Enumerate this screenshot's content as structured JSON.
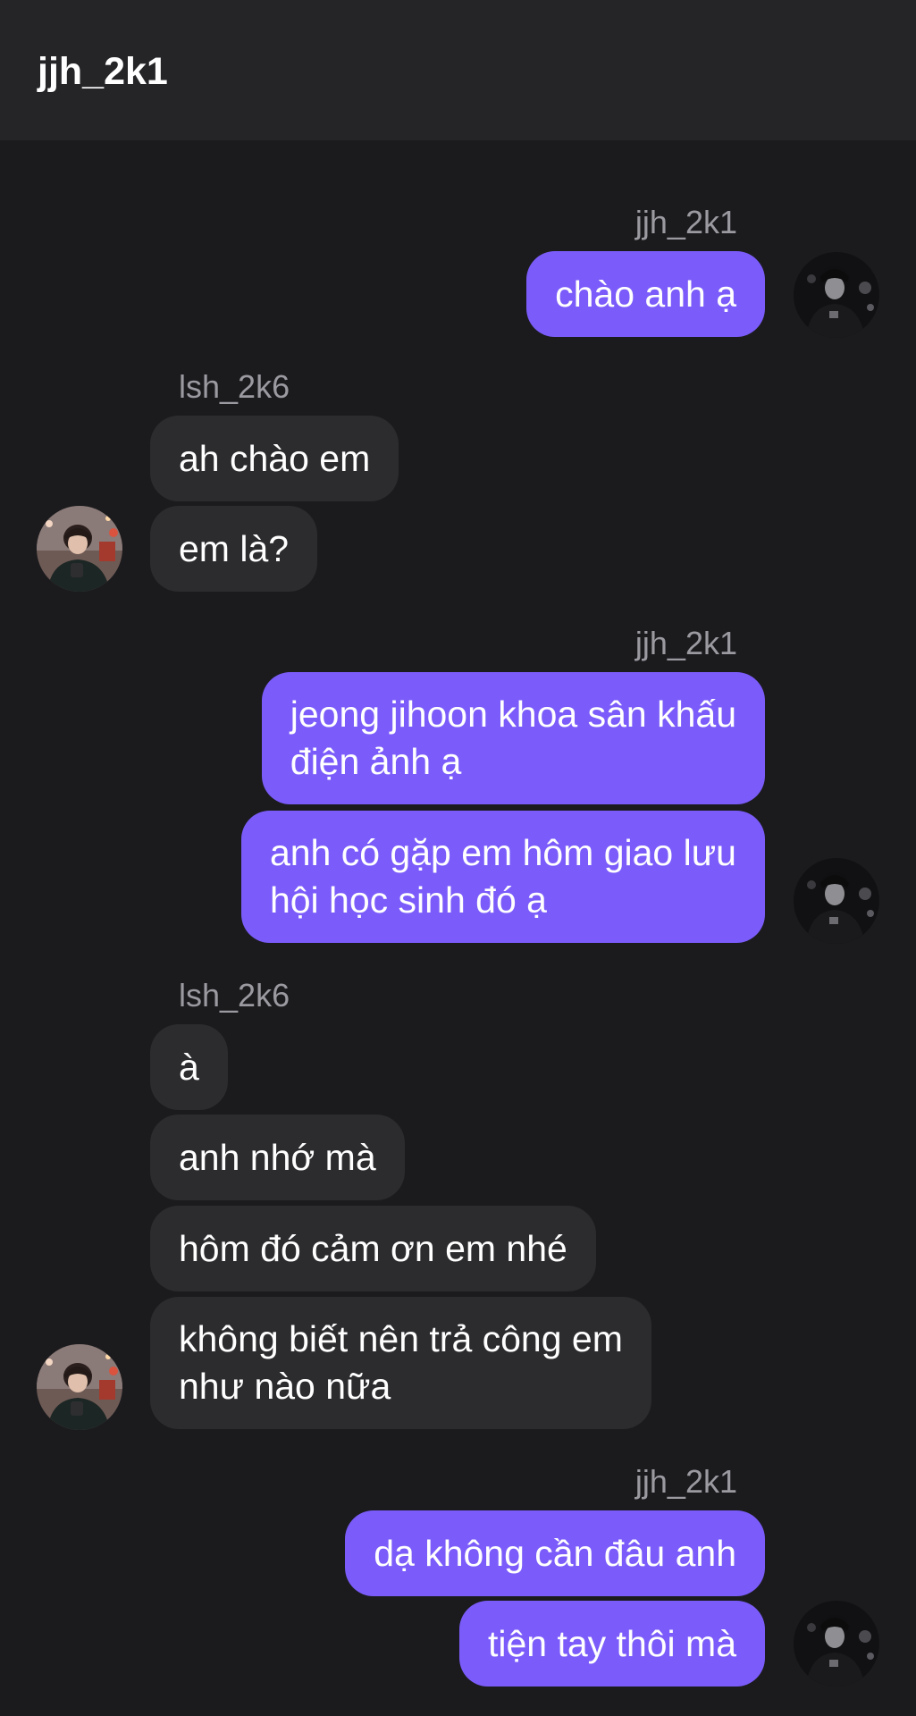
{
  "header": {
    "title": "jjh_2k1"
  },
  "users": {
    "me": "jjh_2k1",
    "other": "lsh_2k6"
  },
  "avatars": {
    "me": "profile-photo-jjh_2k1",
    "other": "profile-photo-lsh_2k6"
  },
  "messages": [
    {
      "sender": "jjh_2k1",
      "text": "chào anh ạ"
    },
    {
      "sender": "lsh_2k6",
      "text": "ah chào em"
    },
    {
      "sender": "lsh_2k6",
      "text": "em là?"
    },
    {
      "sender": "jjh_2k1",
      "text": "jeong jihoon khoa sân khấu\nđiện ảnh ạ"
    },
    {
      "sender": "jjh_2k1",
      "text": "anh có gặp em hôm giao lưu\nhội học sinh đó ạ"
    },
    {
      "sender": "lsh_2k6",
      "text": "à"
    },
    {
      "sender": "lsh_2k6",
      "text": "anh nhớ mà"
    },
    {
      "sender": "lsh_2k6",
      "text": "hôm đó cảm ơn em nhé"
    },
    {
      "sender": "lsh_2k6",
      "text": "không biết nên trả công em\nnhư nào nữa"
    },
    {
      "sender": "jjh_2k1",
      "text": "dạ không cần đâu anh"
    },
    {
      "sender": "jjh_2k1",
      "text": "tiện tay thôi mà"
    }
  ],
  "colors": {
    "background": "#1b1b1e",
    "header": "#252528",
    "my_bubble": "#7b5cfa",
    "their_bubble": "#2c2c2f",
    "sender_name": "#9a9aa0"
  }
}
